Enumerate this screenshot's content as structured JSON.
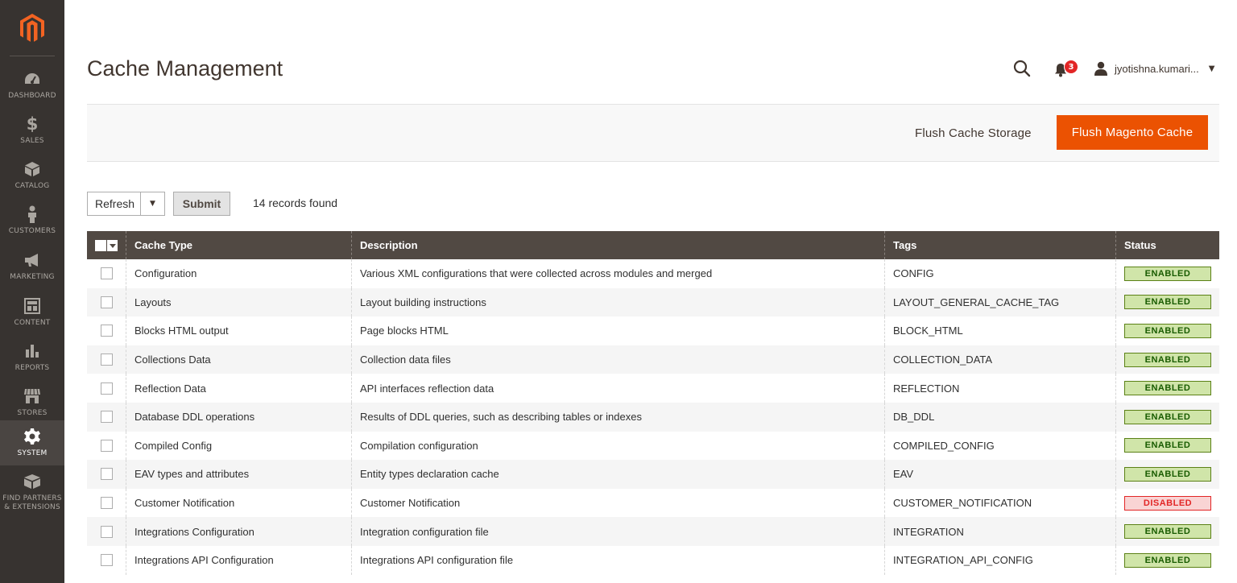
{
  "sidebar": {
    "items": [
      {
        "label": "DASHBOARD",
        "icon": "dashboard-icon"
      },
      {
        "label": "SALES",
        "icon": "dollar-icon"
      },
      {
        "label": "CATALOG",
        "icon": "cube-icon"
      },
      {
        "label": "CUSTOMERS",
        "icon": "person-icon"
      },
      {
        "label": "MARKETING",
        "icon": "megaphone-icon"
      },
      {
        "label": "CONTENT",
        "icon": "layout-icon"
      },
      {
        "label": "REPORTS",
        "icon": "bar-chart-icon"
      },
      {
        "label": "STORES",
        "icon": "storefront-icon"
      },
      {
        "label": "SYSTEM",
        "icon": "gear-icon"
      },
      {
        "label": "FIND PARTNERS & EXTENSIONS",
        "label_line1": "FIND PARTNERS",
        "label_line2": "& EXTENSIONS",
        "icon": "box-icon"
      }
    ],
    "active": "SYSTEM"
  },
  "header": {
    "title": "Cache Management",
    "notifications_count": "3",
    "user_name": "jyotishna.kumari..."
  },
  "actions": {
    "flush_storage_label": "Flush Cache Storage",
    "flush_magento_label": "Flush Magento Cache"
  },
  "mass_action": {
    "selected": "Refresh",
    "submit_label": "Submit",
    "records_found": "14 records found"
  },
  "table": {
    "columns": [
      "Cache Type",
      "Description",
      "Tags",
      "Status"
    ],
    "rows": [
      {
        "type": "Configuration",
        "description": "Various XML configurations that were collected across modules and merged",
        "tags": "CONFIG",
        "status": "ENABLED"
      },
      {
        "type": "Layouts",
        "description": "Layout building instructions",
        "tags": "LAYOUT_GENERAL_CACHE_TAG",
        "status": "ENABLED"
      },
      {
        "type": "Blocks HTML output",
        "description": "Page blocks HTML",
        "tags": "BLOCK_HTML",
        "status": "ENABLED"
      },
      {
        "type": "Collections Data",
        "description": "Collection data files",
        "tags": "COLLECTION_DATA",
        "status": "ENABLED"
      },
      {
        "type": "Reflection Data",
        "description": "API interfaces reflection data",
        "tags": "REFLECTION",
        "status": "ENABLED"
      },
      {
        "type": "Database DDL operations",
        "description": "Results of DDL queries, such as describing tables or indexes",
        "tags": "DB_DDL",
        "status": "ENABLED"
      },
      {
        "type": "Compiled Config",
        "description": "Compilation configuration",
        "tags": "COMPILED_CONFIG",
        "status": "ENABLED"
      },
      {
        "type": "EAV types and attributes",
        "description": "Entity types declaration cache",
        "tags": "EAV",
        "status": "ENABLED"
      },
      {
        "type": "Customer Notification",
        "description": "Customer Notification",
        "tags": "CUSTOMER_NOTIFICATION",
        "status": "DISABLED"
      },
      {
        "type": "Integrations Configuration",
        "description": "Integration configuration file",
        "tags": "INTEGRATION",
        "status": "ENABLED"
      },
      {
        "type": "Integrations API Configuration",
        "description": "Integrations API configuration file",
        "tags": "INTEGRATION_API_CONFIG",
        "status": "ENABLED"
      }
    ]
  },
  "colors": {
    "accent": "#eb5202",
    "sidebar": "#373330",
    "header_row": "#514943",
    "enabled_bg": "#d0e5a9",
    "disabled_bg": "#f9d4d4"
  }
}
